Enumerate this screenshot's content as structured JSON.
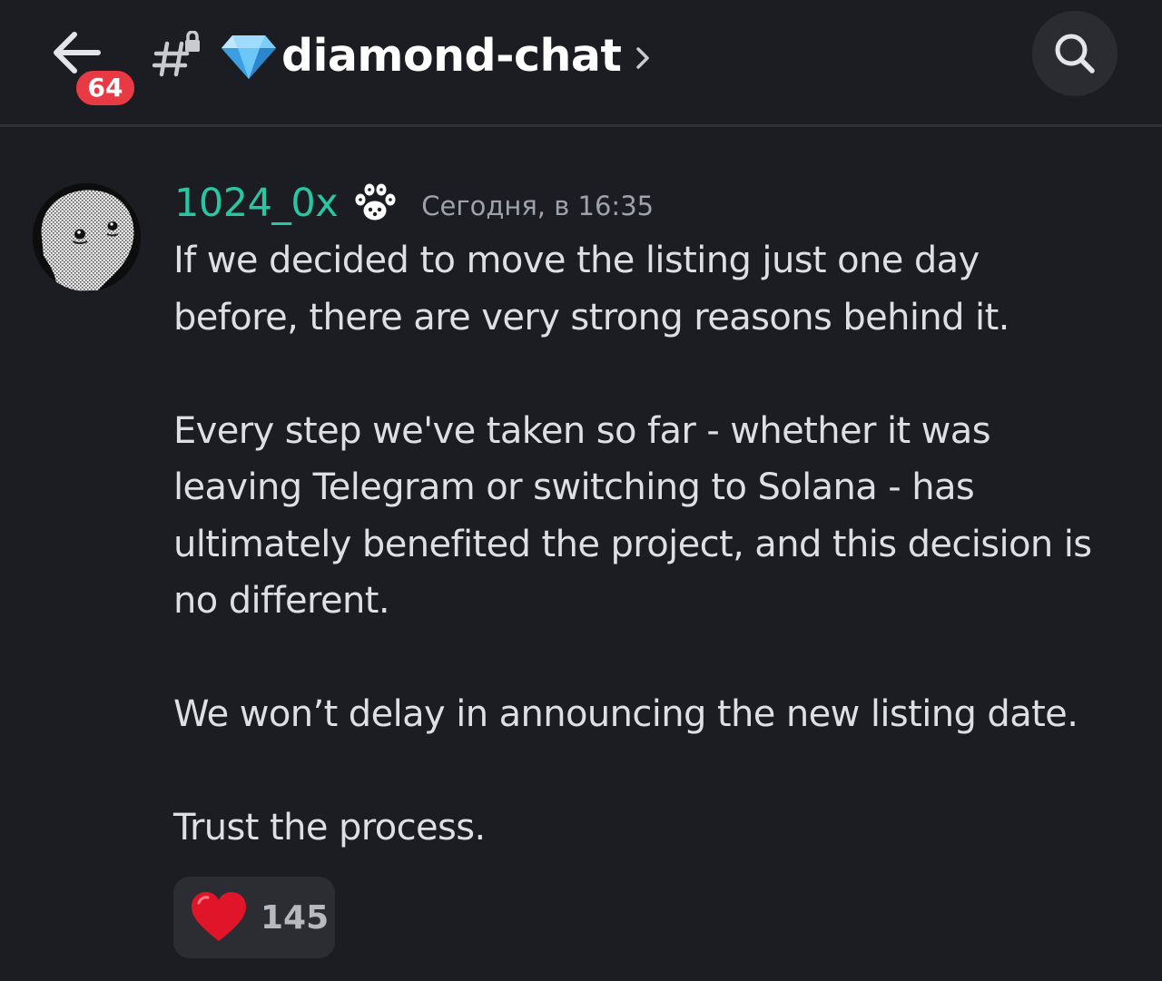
{
  "header": {
    "unread_count": "64",
    "channel_name": "diamond-chat",
    "back_icon": "arrow-left-icon",
    "hash_icon": "locked-hash-icon",
    "channel_emoji": "diamond-icon",
    "chevron_icon": "chevron-right-icon",
    "search_icon": "search-icon"
  },
  "message": {
    "author": "1024_0x",
    "author_color": "#27c7a4",
    "badge_icon": "paw-icon",
    "timestamp": "Сегодня, в 16:35",
    "paragraphs": [
      "If we decided to move the listing just one day\nbefore, there are very strong reasons behind it.",
      "Every step we've taken so far - whether it was\nleaving Telegram or switching to Solana - has\nultimately benefited the project, and this decision is\nno different.",
      "We won’t delay in announcing the new listing date.",
      "Trust the process."
    ],
    "reaction": {
      "emoji": "heart-icon",
      "count": "145"
    }
  },
  "colors": {
    "background": "#1c1d22",
    "badge": "#e83a45",
    "reaction_bg": "#2b2d33"
  }
}
